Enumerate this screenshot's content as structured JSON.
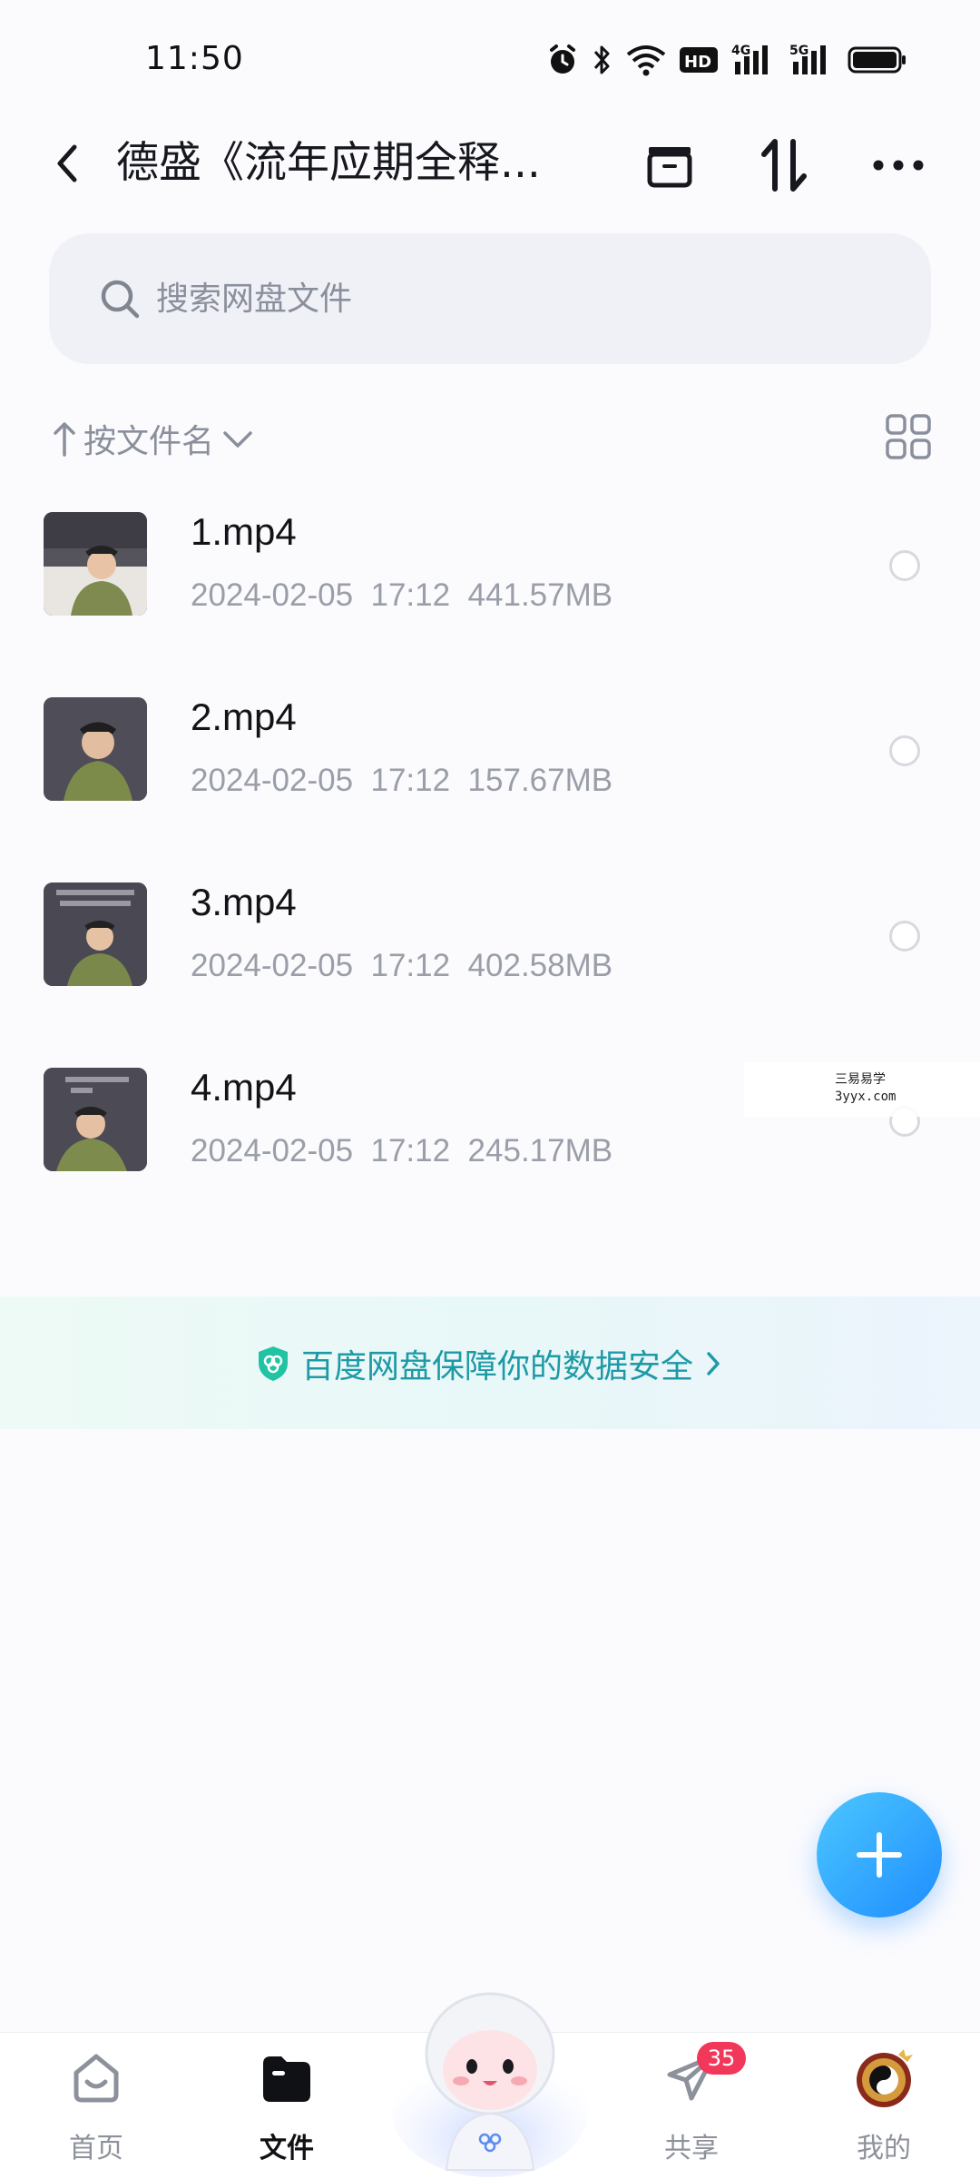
{
  "status_bar": {
    "time": "11:50",
    "network_hd": "HD",
    "network_4g": "4G",
    "network_5g": "5G"
  },
  "header": {
    "title": "德盛《流年应期全释..."
  },
  "search": {
    "placeholder": "搜索网盘文件"
  },
  "sort": {
    "label": "按文件名"
  },
  "files": [
    {
      "name": "1.mp4",
      "date": "2024-02-05",
      "time": "17:12",
      "size": "441.57MB"
    },
    {
      "name": "2.mp4",
      "date": "2024-02-05",
      "time": "17:12",
      "size": "157.67MB"
    },
    {
      "name": "3.mp4",
      "date": "2024-02-05",
      "time": "17:12",
      "size": "402.58MB"
    },
    {
      "name": "4.mp4",
      "date": "2024-02-05",
      "time": "17:12",
      "size": "245.17MB"
    }
  ],
  "watermark": {
    "line1": "三易易学",
    "line2": "3yyx.com"
  },
  "security_banner": {
    "text": "百度网盘保障你的数据安全"
  },
  "nav": {
    "home": "首页",
    "files": "文件",
    "share": "共享",
    "share_badge": "35",
    "me": "我的"
  },
  "colors": {
    "accent": "#1e8dff",
    "security_text": "#1d9aa6",
    "badge": "#f2385a"
  },
  "icons": [
    "back-arrow-icon",
    "archive-icon",
    "sort-icon",
    "more-icon",
    "search-icon",
    "sort-up-arrow-icon",
    "chevron-down-icon",
    "grid-view-icon",
    "shield-icon",
    "plus-icon",
    "home-icon",
    "folder-icon",
    "send-icon",
    "avatar"
  ]
}
